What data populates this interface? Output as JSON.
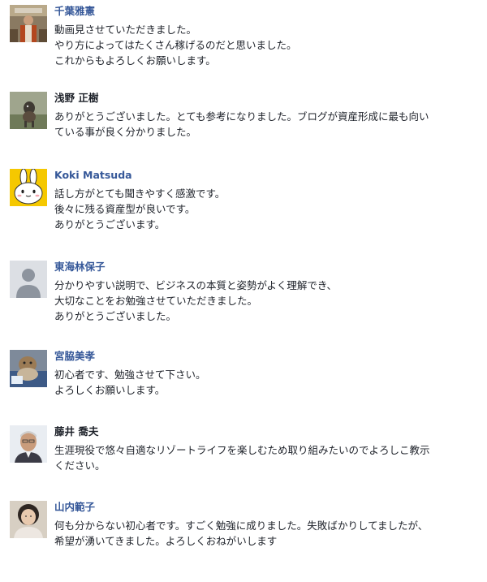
{
  "comments": [
    {
      "author": "千葉雅憲",
      "avatar_icon": "person-photo-icon",
      "lines": [
        "動画見させていただきました。",
        "やり方によってはたくさん稼げるのだと思いました。",
        "これからもよろしくお願いします。"
      ]
    },
    {
      "author": "浅野 正樹",
      "avatar_icon": "dog-photo-icon",
      "lines": [
        "ありがとうございました。とても参考になりました。ブログが資産形成に最も向い",
        "ている事が良く分かりました。"
      ]
    },
    {
      "author": "Koki Matsuda",
      "avatar_icon": "rabbit-icon",
      "lines": [
        "話し方がとても聞きやすく感激です。",
        "後々に残る資産型が良いです。",
        "ありがとうございます。"
      ]
    },
    {
      "author": "東海林保子",
      "avatar_icon": "default-user-icon",
      "lines": [
        "分かりやすい説明で、ビジネスの本質と姿勢がよく理解でき、",
        "大切なことをお勉強させていただきました。",
        "ありがとうございました。"
      ]
    },
    {
      "author": "宮脇美孝",
      "avatar_icon": "pet-photo-icon",
      "lines": [
        "初心者です、勉強させて下さい。",
        "よろしくお願いします。"
      ]
    },
    {
      "author": "藤井 喬夫",
      "avatar_icon": "person-photo-icon",
      "lines": [
        "生涯現役で悠々自適なリゾートライフを楽しむため取り組みたいのでよろしこ教示",
        "ください。"
      ]
    },
    {
      "author": "山内範子",
      "avatar_icon": "person-photo-icon",
      "lines": [
        "何も分からない初心者です。すごく勉強に成りました。失敗ばかりしてましたが、",
        "希望が湧いてきました。よろしくおねがいします"
      ]
    }
  ],
  "colors": {
    "author_link": "#365899",
    "text": "#1d2129",
    "default_avatar_bg": "#dcdfe4",
    "default_avatar_fg": "#8d949e",
    "rabbit_bg": "#f5c800"
  }
}
